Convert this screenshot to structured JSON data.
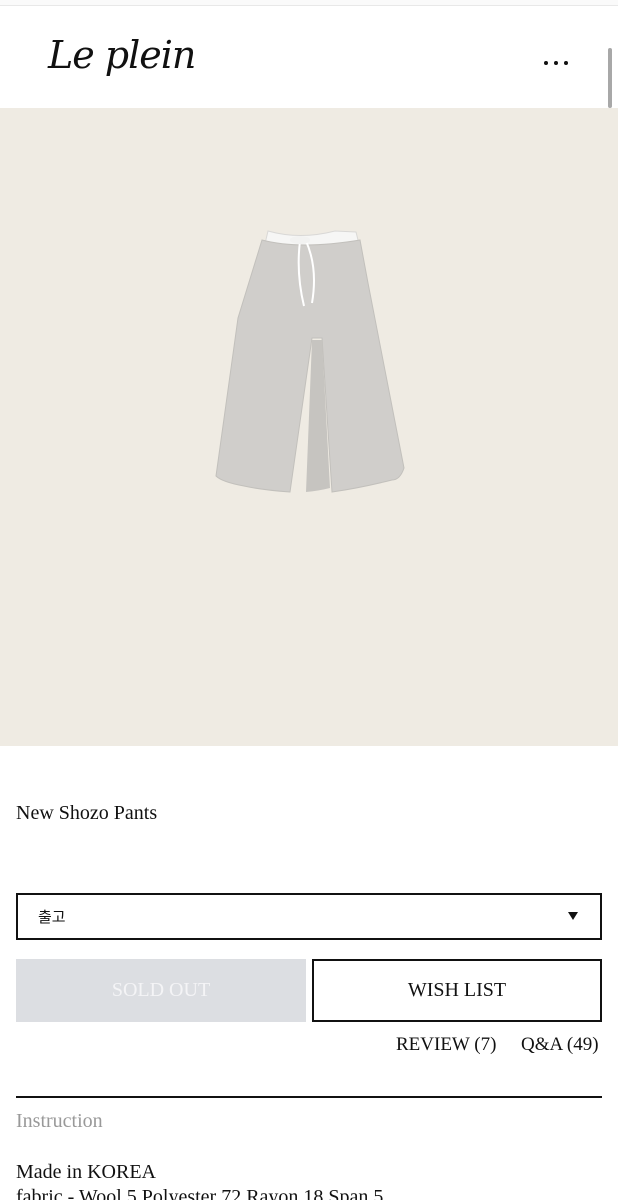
{
  "brand": {
    "logo_text": "Le plein"
  },
  "header": {
    "menu_icon": "more-dots-icon"
  },
  "product": {
    "name": "New Shozo Pants",
    "image_icon": "product-photo-pants",
    "option_select": {
      "selected": "출고"
    },
    "buttons": {
      "sold_out": "SOLD OUT",
      "wish_list": "WISH LIST"
    },
    "links": {
      "review": "REVIEW (7)",
      "qa": "Q&A (49)"
    }
  },
  "details": {
    "section_title": "Instruction",
    "made_in": "Made in KOREA",
    "fabric": "fabric - Wool 5 Polyester 72 Rayon 18 Span 5"
  },
  "colors": {
    "hero_bg": "#efebe3",
    "sold_out_bg": "#dcdee2",
    "pants": "#d0cecb"
  }
}
